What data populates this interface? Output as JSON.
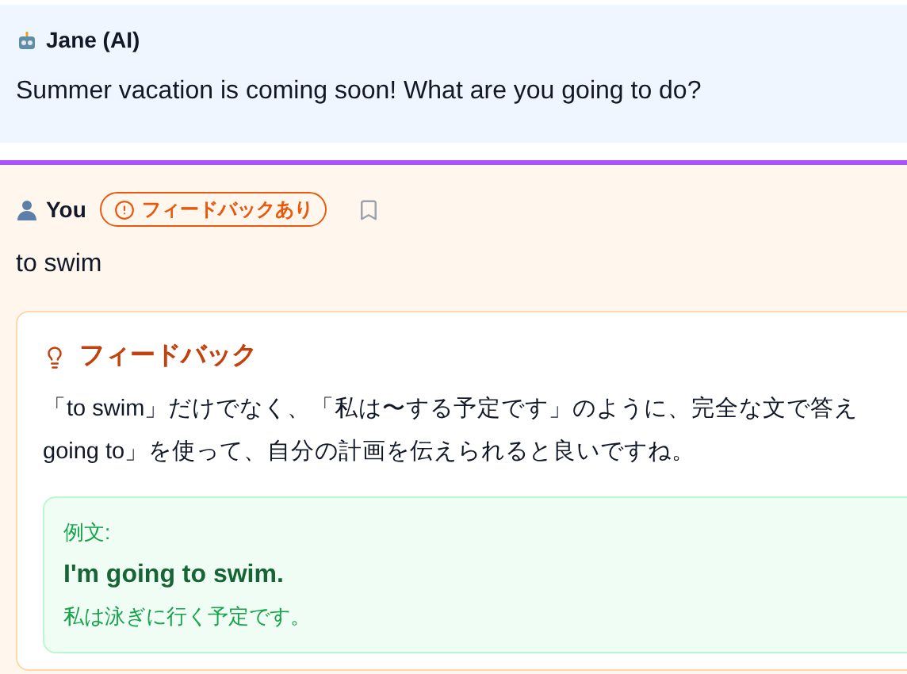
{
  "ai_message": {
    "sender": "Jane (AI)",
    "text": "Summer vacation is coming soon! What are you going to do?"
  },
  "user_message": {
    "sender": "You",
    "badge": "フィードバックあり",
    "bookmarked": false,
    "text": "to swim",
    "feedback": {
      "title": "フィードバック",
      "lines": [
        "「to swim」だけでなく、「私は〜する予定です」のように、完全な文で答え",
        "going to」を使って、自分の計画を伝えられると良いですね。"
      ],
      "example": {
        "label": "例文:",
        "sentence": "I'm going to swim.",
        "translation": "私は泳ぎに行く予定です。"
      }
    }
  }
}
